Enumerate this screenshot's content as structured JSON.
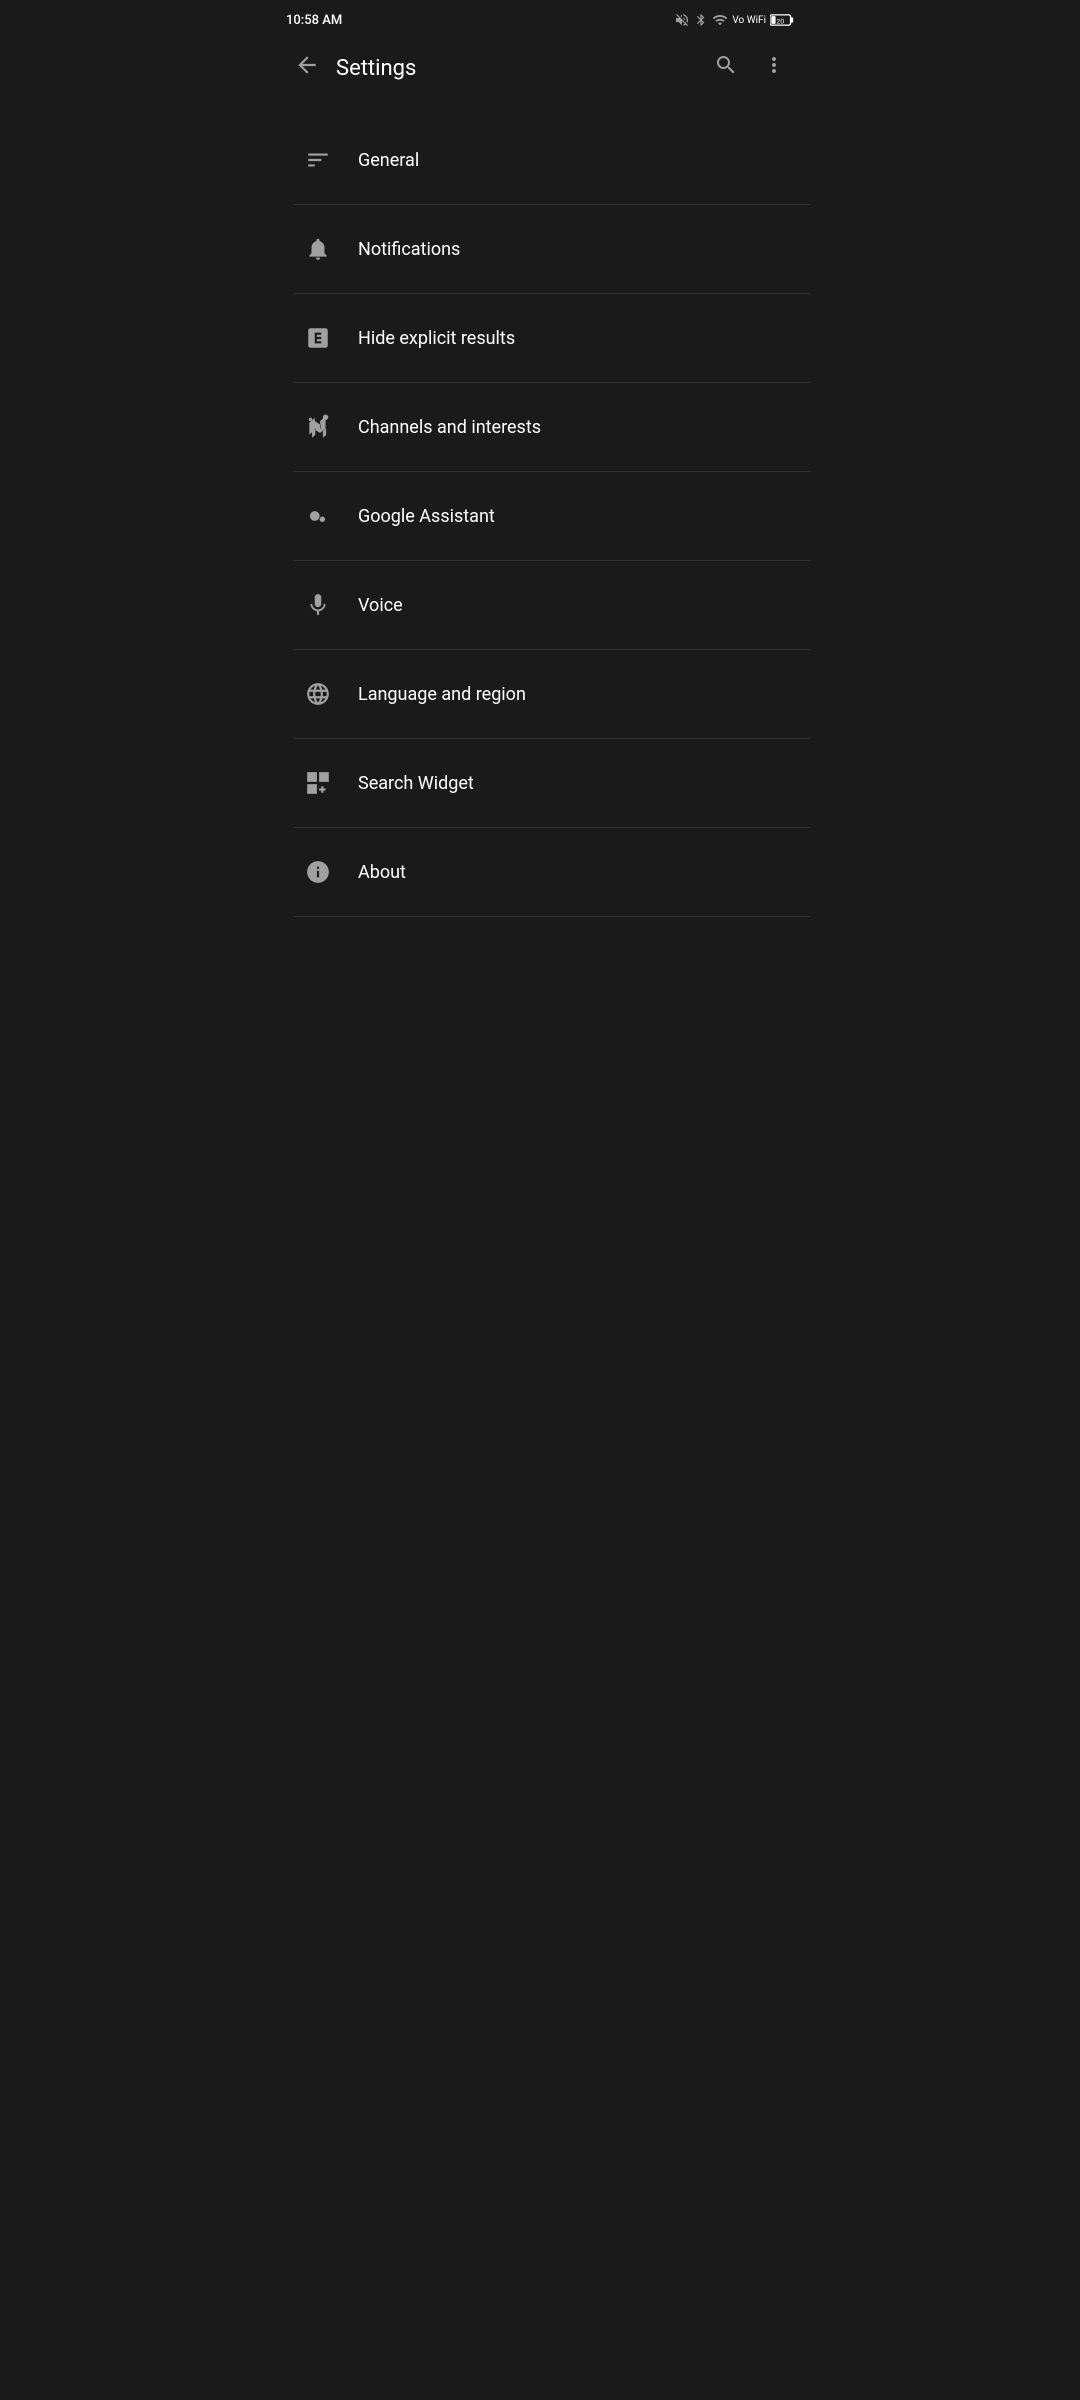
{
  "status_bar": {
    "time": "10:58 AM",
    "bluetooth_icon": "bluetooth",
    "battery_level": "20"
  },
  "app_bar": {
    "title": "Settings",
    "back_label": "←",
    "search_label": "🔍",
    "more_label": "⋮"
  },
  "settings_items": [
    {
      "id": "general",
      "label": "General",
      "icon": "general"
    },
    {
      "id": "notifications",
      "label": "Notifications",
      "icon": "notifications"
    },
    {
      "id": "hide-explicit",
      "label": "Hide explicit results",
      "icon": "explicit"
    },
    {
      "id": "channels-interests",
      "label": "Channels and interests",
      "icon": "channels"
    },
    {
      "id": "google-assistant",
      "label": "Google Assistant",
      "icon": "assistant"
    },
    {
      "id": "voice",
      "label": "Voice",
      "icon": "voice"
    },
    {
      "id": "language-region",
      "label": "Language and region",
      "icon": "language"
    },
    {
      "id": "search-widget",
      "label": "Search Widget",
      "icon": "widget"
    },
    {
      "id": "about",
      "label": "About",
      "icon": "about"
    }
  ]
}
